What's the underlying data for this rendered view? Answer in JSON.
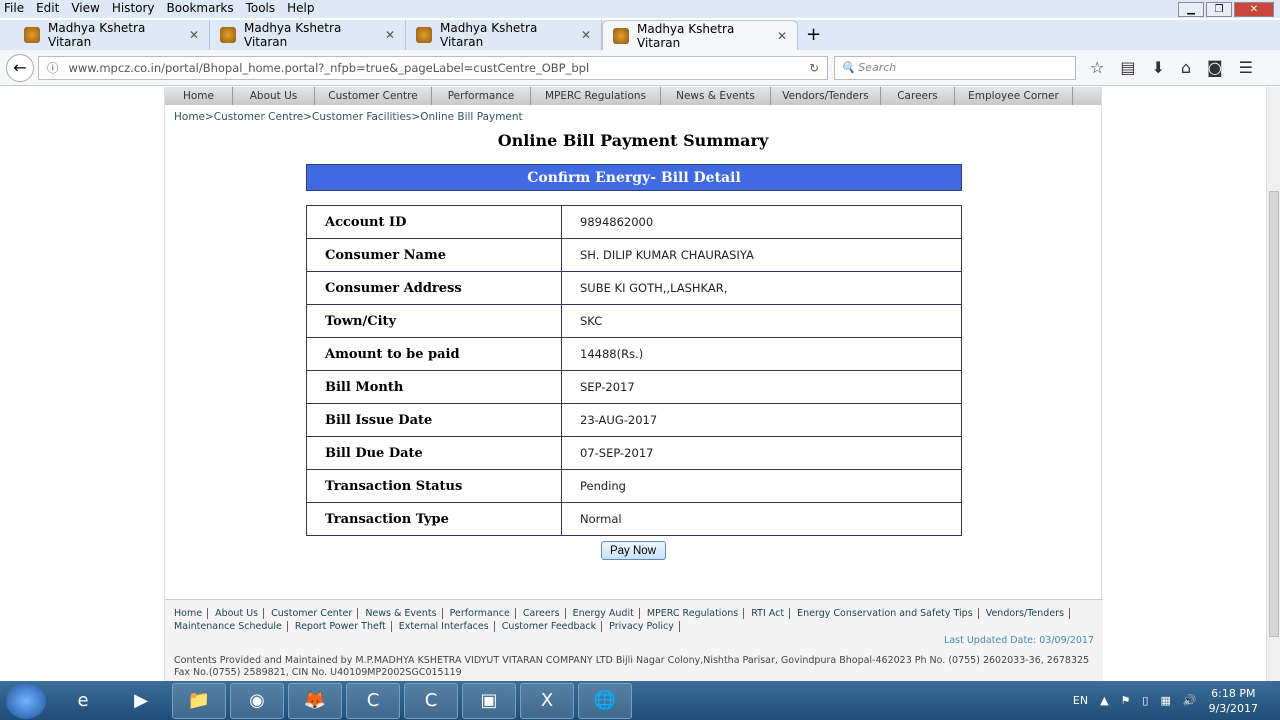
{
  "browser": {
    "menu": [
      "File",
      "Edit",
      "View",
      "History",
      "Bookmarks",
      "Tools",
      "Help"
    ],
    "tabs": [
      {
        "title": "Madhya Kshetra Vitaran",
        "active": false
      },
      {
        "title": "Madhya Kshetra Vitaran",
        "active": false
      },
      {
        "title": "Madhya Kshetra Vitaran",
        "active": false
      },
      {
        "title": "Madhya Kshetra Vitaran",
        "active": true
      }
    ],
    "url": "www.mpcz.co.in/portal/Bhopal_home.portal?_nfpb=true&_pageLabel=custCentre_OBP_bpl",
    "search_placeholder": "Search"
  },
  "site": {
    "nav": [
      "Home",
      "About Us",
      "Customer Centre",
      "Performance",
      "MPERC Regulations",
      "News & Events",
      "Vendors/Tenders",
      "Careers",
      "Employee Corner"
    ],
    "breadcrumb": "Home>Customer Centre>Customer Facilities>Online Bill Payment",
    "title": "Online Bill Payment Summary",
    "confirm_header": "Confirm Energy- Bill Detail",
    "confirm_color": "#4169e1",
    "rows": [
      {
        "label": "Account ID",
        "value": "9894862000"
      },
      {
        "label": "Consumer Name",
        "value": "SH. DILIP KUMAR CHAURASIYA"
      },
      {
        "label": "Consumer Address",
        "value": "SUBE KI GOTH,,LASHKAR,"
      },
      {
        "label": "Town/City",
        "value": "SKC"
      },
      {
        "label": "Amount to be paid",
        "value": "14488(Rs.)"
      },
      {
        "label": "Bill Month",
        "value": "SEP-2017"
      },
      {
        "label": "Bill Issue Date",
        "value": "23-AUG-2017"
      },
      {
        "label": "Bill Due Date",
        "value": "07-SEP-2017"
      },
      {
        "label": "Transaction Status",
        "value": "Pending"
      },
      {
        "label": "Transaction Type",
        "value": "Normal"
      }
    ],
    "pay_button": "Pay Now",
    "footer_links": [
      "Home",
      "About Us",
      "Customer Center",
      "News & Events",
      "Performance",
      "Careers",
      "Energy Audit",
      "MPERC Regulations",
      "RTI Act",
      "Energy Conservation and Safety Tips",
      "Vendors/Tenders",
      "Maintenance Schedule",
      "Report Power Theft",
      "External Interfaces",
      "Customer Feedback",
      "Privacy Policy"
    ],
    "last_updated": "Last Updated Date: 03/09/2017",
    "copyright": "Contents Provided and Maintained by M.P.MADHYA KSHETRA VIDYUT VITARAN COMPANY LTD Bijli Nagar Colony,Nishtha Parisar, Govindpura Bhopal-462023 Ph No. (0755) 2602033-36, 2678325 Fax No.(0755) 2589821, CIN No. U40109MP2002SGC015119"
  },
  "taskbar": {
    "lang": "EN",
    "time": "6:18 PM",
    "date": "9/3/2017"
  }
}
